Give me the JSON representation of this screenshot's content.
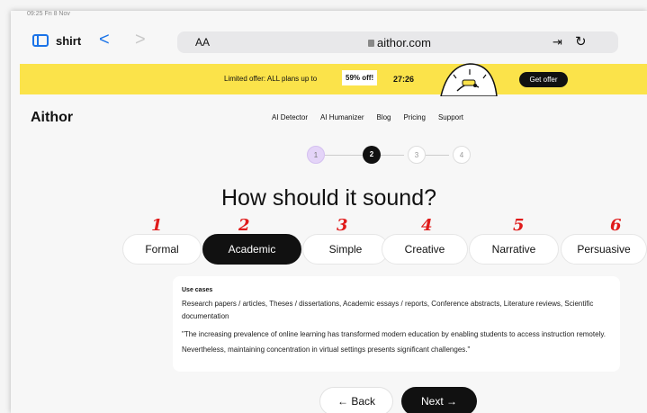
{
  "status": {
    "text": "09:25  Fri 8 Nov"
  },
  "browser": {
    "tab_label": "shirt",
    "aa": "AA",
    "url": "aithor.com",
    "back_glyph": "<",
    "forward_glyph": ">",
    "icons": [
      "tabs-icon",
      "lock-icon",
      "extension-icon",
      "reload-icon"
    ]
  },
  "promo": {
    "text": "Limited offer: ALL plans up to",
    "discount": "59% off!",
    "timer": "27:26",
    "cta": "Get offer",
    "bg_color": "#fbe34a"
  },
  "site": {
    "logo": "Aithor",
    "nav": [
      "AI Detector",
      "AI Humanizer",
      "Blog",
      "Pricing",
      "Support"
    ]
  },
  "stepper": {
    "steps": [
      "1",
      "2",
      "3",
      "4"
    ],
    "current": 2
  },
  "heading": "How should it sound?",
  "annotations": [
    "1",
    "2",
    "3",
    "4",
    "5",
    "6"
  ],
  "styles": [
    "Formal",
    "Academic",
    "Simple",
    "Creative",
    "Narrative",
    "Persuasive"
  ],
  "selected_style": "Academic",
  "card": {
    "title": "Use cases",
    "body": "Research papers / articles, Theses / dissertations, Academic essays / reports, Conference abstracts, Literature reviews, Scientific documentation",
    "quote": "\"The increasing prevalence of online learning has transformed modern education by enabling students to access instruction remotely. Nevertheless, maintaining concentration in virtual settings presents significant challenges.\""
  },
  "buttons": {
    "back": "← Back",
    "next": "Next →"
  },
  "colors": {
    "accent": "#1a73e8",
    "annotation": "#e01b1b",
    "primary": "#111111"
  }
}
